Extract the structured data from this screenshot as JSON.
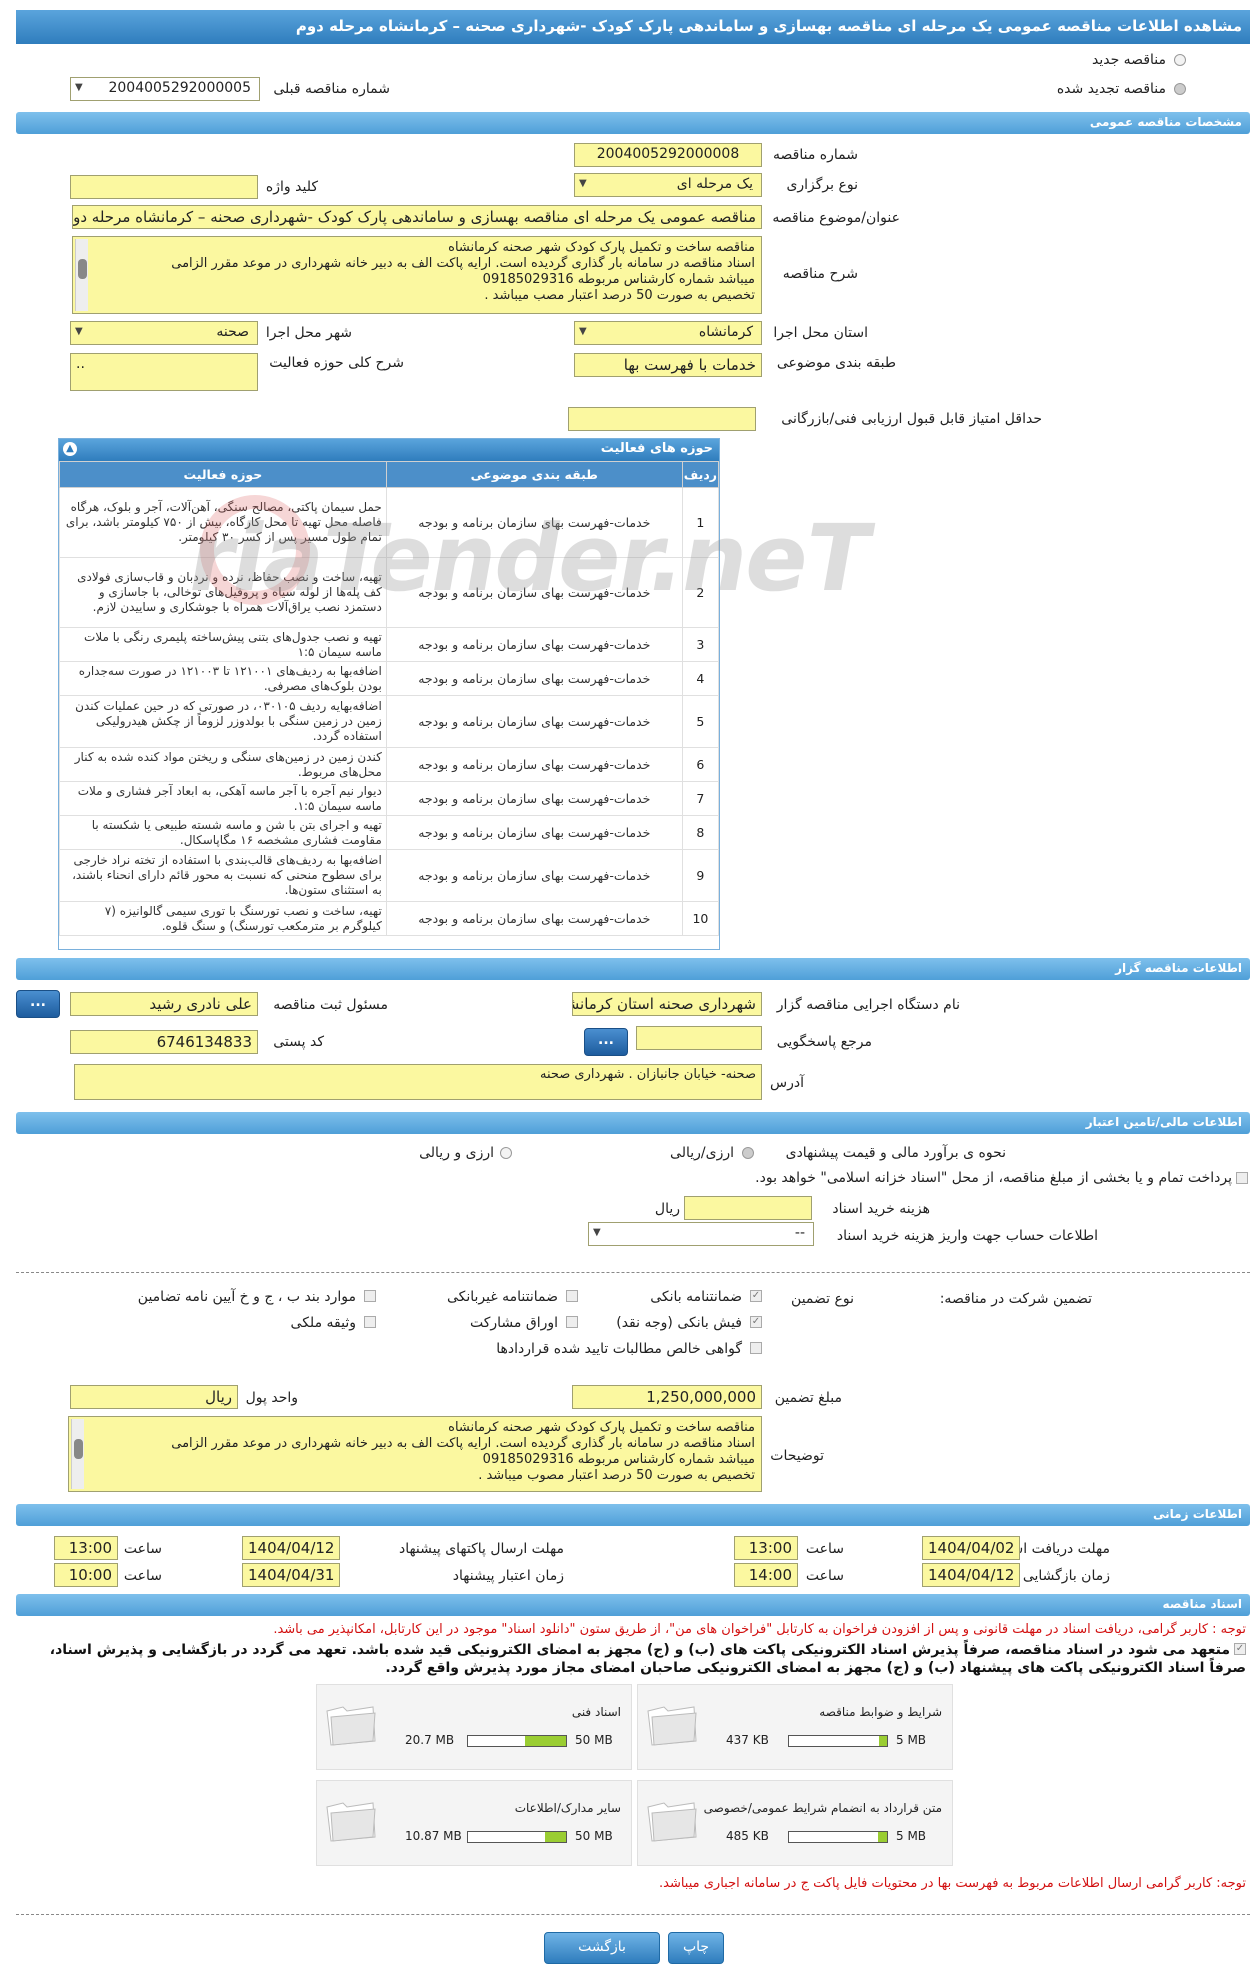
{
  "page_title": "مشاهده اطلاعات مناقصه عمومی یک مرحله ای مناقصه بهسازی و ساماندهی پارک کودک -شهرداری صحنه – کرمانشاه مرحله دوم",
  "tender_type": {
    "new_label": "مناقصه جدید",
    "renewed_label": "مناقصه تجدید شده",
    "prev_number_label": "شماره مناقصه قبلی",
    "prev_number": "2004005292000005"
  },
  "general": {
    "section_title": "مشخصات مناقصه عمومی",
    "number_label": "شماره مناقصه",
    "number": "2004005292000008",
    "holding_type_label": "نوع برگزاری",
    "holding_type": "یک مرحله ای",
    "keyword_label": "کلید واژه",
    "keyword": "",
    "subject_label": "عنوان/موضوع مناقصه",
    "subject": "مناقصه عمومی یک مرحله ای مناقصه  بهسازی و ساماندهی پارک کودک -شهرداری صحنه – کرمانشاه مرحله دوم",
    "desc_label": "شرح مناقصه",
    "desc_lines": [
      "مناقصه ساخت و تکمیل  پارک کودک  شهر صحنه کرمانشاه",
      "اسناد مناقصه در سامانه بار گذاری گردیده است. ارایه پاکت الف به دبیر خانه شهرداری در موعد مقرر الزامی",
      "میباشد   شماره کارشناس مربوطه 09185029316",
      "تخصیص  به صورت 50 درصد اعتبار مصب میباشد ."
    ],
    "province_label": "استان محل اجرا",
    "province": "کرمانشاه",
    "city_label": "شهر محل اجرا",
    "city": "صحنه",
    "category_label": "طبقه بندی موضوعی",
    "category": "خدمات با فهرست بها",
    "activity_desc_label": "شرح کلی حوزه فعالیت",
    "activity_desc": "..",
    "min_score_label": "حداقل امتیاز قابل قبول ارزیابی فنی/بازرگانی",
    "min_score": ""
  },
  "activities": {
    "title": "حوزه های فعالیت",
    "col_row": "ردیف",
    "col_category": "طبقه بندی موضوعی",
    "col_field": "حوزه فعالیت",
    "rows": [
      {
        "n": "1",
        "cat": "خدمات-فهرست بهای سازمان برنامه و بودجه",
        "desc": "حمل سیمان پاکتی، مصالح سنگی، آهن‌آلات، آجر و بلوک، هرگاه فاصله محل تهیه تا محل کارگاه، بیش از ۷۵۰ کیلومتر باشد، برای تمام طول مسیر پس از کسر ۳۰ کیلومتر."
      },
      {
        "n": "2",
        "cat": "خدمات-فهرست بهای سازمان برنامه و بودجه",
        "desc": "تهیه، ساخت و نصب حفاظ، نرده و نردبان و قاب‌سازی فولادی کف پله‌ها از لوله سیاه و پروفیل‌های توخالی، با جاسازی و دستمزد نصب یراق‌آلات همراه با جوشکاری و ساییدن لازم."
      },
      {
        "n": "3",
        "cat": "خدمات-فهرست بهای سازمان برنامه و بودجه",
        "desc": "تهیه و نصب جدول‌های بتنی پیش‌ساخته پلیمری رنگی با ملات ماسه  سیمان ۱:۵"
      },
      {
        "n": "4",
        "cat": "خدمات-فهرست بهای سازمان برنامه و بودجه",
        "desc": "اضافه‌بها به ردیف‌های ۱۲۱۰۰۱ تا ۱۲۱۰۰۳ در صورت سه‌جداره بودن بلوک‌های مصرفی."
      },
      {
        "n": "5",
        "cat": "خدمات-فهرست بهای سازمان برنامه و بودجه",
        "desc": "اضافه‌بهایه ردیف ۰۳۰۱۰۵، در صورتی که در حین عملیات کندن زمین در زمین سنگی با بولدوزر لزوماً از چکش هیدرولیکی استفاده گردد."
      },
      {
        "n": "6",
        "cat": "خدمات-فهرست بهای سازمان برنامه و بودجه",
        "desc": "کندن زمین در زمین‌های سنگی و ریختن مواد کنده شده به کنار محل‌های مربوط."
      },
      {
        "n": "7",
        "cat": "خدمات-فهرست بهای سازمان برنامه و بودجه",
        "desc": "دیوار نیم آجره با آجر ماسه آهکی، به ابعاد آجر فشاری و ملات ماسه سیمان ۱:۵."
      },
      {
        "n": "8",
        "cat": "خدمات-فهرست بهای سازمان برنامه و بودجه",
        "desc": "تهیه و اجرای بتن با شن و ماسه شسته طبیعی یا شکسته با مقاومت فشاری مشخصه ۱۶ مگاپاسکال."
      },
      {
        "n": "9",
        "cat": "خدمات-فهرست بهای سازمان برنامه و بودجه",
        "desc": "اضافه‌بها به ردیف‌های قالب‌بندی با استفاده از تخته نراد خارجی برای سطوح منحنی که نسبت به محور قائم دارای انحناء باشند، به استثنای ستون‌ها."
      },
      {
        "n": "10",
        "cat": "خدمات-فهرست بهای سازمان برنامه و بودجه",
        "desc": "تهیه، ساخت و نصب تورسنگ با توری سیمی گالوانیزه (۷ کیلوگرم بر مترمکعب تورسنگ) و سنگ قلوه."
      }
    ]
  },
  "organizer": {
    "section_title": "اطلاعات مناقصه گزار",
    "org_label": "نام دستگاه اجرایی مناقصه گزار",
    "org": "شهرداری صحنه استان کرمانشاه",
    "registrar_label": "مسئول ثبت مناقصه",
    "registrar": "علی نادری رشید",
    "respondent_label": "مرجع پاسخگویی",
    "respondent": "",
    "postal_label": "کد پستی",
    "postal": "6746134833",
    "address_label": "آدرس",
    "address": "صحنه-  خیابان جانبازان .  شهرداری صحنه",
    "dots": "..."
  },
  "finance": {
    "section_title": "اطلاعات مالی/تامین اعتبار",
    "estimate_label": "نحوه ی برآورد مالی و قیمت پیشنهادی",
    "opt_rial": "ارزی/ریالی",
    "opt_fx": "ارزی و ریالی",
    "treasury_text": "پرداخت تمام و یا بخشی از مبلغ مناقصه، از محل \"اسناد خزانه اسلامی\" خواهد بود.",
    "doc_fee_label": "هزینه خرید اسناد",
    "doc_fee": "",
    "doc_fee_unit": "ریال",
    "account_label": "اطلاعات حساب جهت واریز هزینه خرید اسناد",
    "account": "--"
  },
  "guarantee": {
    "title_label": "تضمین شرکت در مناقصه:",
    "type_label": "نوع تضمین",
    "opts": {
      "bank_guarantee": "ضمانتنامه بانکی",
      "nonbank_guarantee": "ضمانتنامه غیربانکی",
      "bylaw_items": "موارد بند ب ، ج و خ آیین نامه تضامین",
      "bank_receipt": "فیش بانکی (وجه نقد)",
      "bonds": "اوراق مشارکت",
      "property": "وثیقه ملکی",
      "contract_claims": "گواهی خالص مطالبات تایید شده قراردادها"
    },
    "amount_label": "مبلغ تضمین",
    "amount": "1,250,000,000",
    "currency_label": "واحد پول",
    "currency": "ریال",
    "notes_label": "توضیحات",
    "notes_lines": [
      "مناقصه ساخت و تکمیل  پارک کودک  شهر صحنه کرمانشاه",
      "اسناد مناقصه در سامانه بار گذاری گردیده است. ارایه پاکت الف به دبیر خانه شهرداری در موعد مقرر الزامی",
      "میباشد   شماره کارشناس مربوطه 09185029316",
      "تخصیص  به صورت 50 درصد اعتبار مصوب میباشد ."
    ]
  },
  "timing": {
    "section_title": "اطلاعات زمانی",
    "receive_label": "مهلت دریافت اسناد",
    "receive_date": "1404/04/02",
    "receive_time": "13:00",
    "send_label": "مهلت ارسال پاکتهای پیشنهاد",
    "send_date": "1404/04/12",
    "send_time": "13:00",
    "open_label": "زمان بازگشایی پاکت ها",
    "open_date": "1404/04/12",
    "open_time": "14:00",
    "valid_label": "زمان اعتبار پیشنهاد",
    "valid_date": "1404/04/31",
    "valid_time": "10:00",
    "time_label": "ساعت"
  },
  "documents": {
    "section_title": "اسناد مناقصه",
    "note1": "توجه : کاربر گرامی، دریافت اسناد در مهلت قانونی و پس از افزودن فراخوان به کارتابل \"فراخوان های من\"، از طریق ستون \"دانلود اسناد\" موجود در این کارتابل، امکانپذیر می باشد.",
    "commit_line1": "متعهد می شود در اسناد مناقصه، صرفاً پذیرش اسناد الکترونیکی پاکت های (ب) و (ج) مجهز به امضای الکترونیکی قید شده باشد. تعهد می گردد در بازگشایی و پذیرش اسناد،",
    "commit_line2": "صرفاً اسناد الکترونیکی پاکت های پیشنهاد (ب) و (ج) مجهز به امضای الکترونیکی صاحبان امضای مجاز مورد پذیرش واقع گردد.",
    "files": [
      {
        "name": "شرایط و ضوابط مناقصه",
        "used": "437 KB",
        "max": "5 MB",
        "fill": 0.085
      },
      {
        "name": "اسناد فنی",
        "used": "20.7 MB",
        "max": "50 MB",
        "fill": 0.414
      },
      {
        "name": "متن قرارداد به انضمام شرایط عمومی/خصوصی",
        "used": "485 KB",
        "max": "5 MB",
        "fill": 0.095
      },
      {
        "name": "سایر مدارک/اطلاعات",
        "used": "10.87 MB",
        "max": "50 MB",
        "fill": 0.217
      }
    ],
    "note2": "توجه: کاربر گرامی ارسال اطلاعات مربوط به فهرست بها در محتویات فایل پاکت ج در سامانه اجباری میباشد."
  },
  "buttons": {
    "print": "چاپ",
    "back": "بازگشت"
  },
  "watermark": "riaTender.neT"
}
